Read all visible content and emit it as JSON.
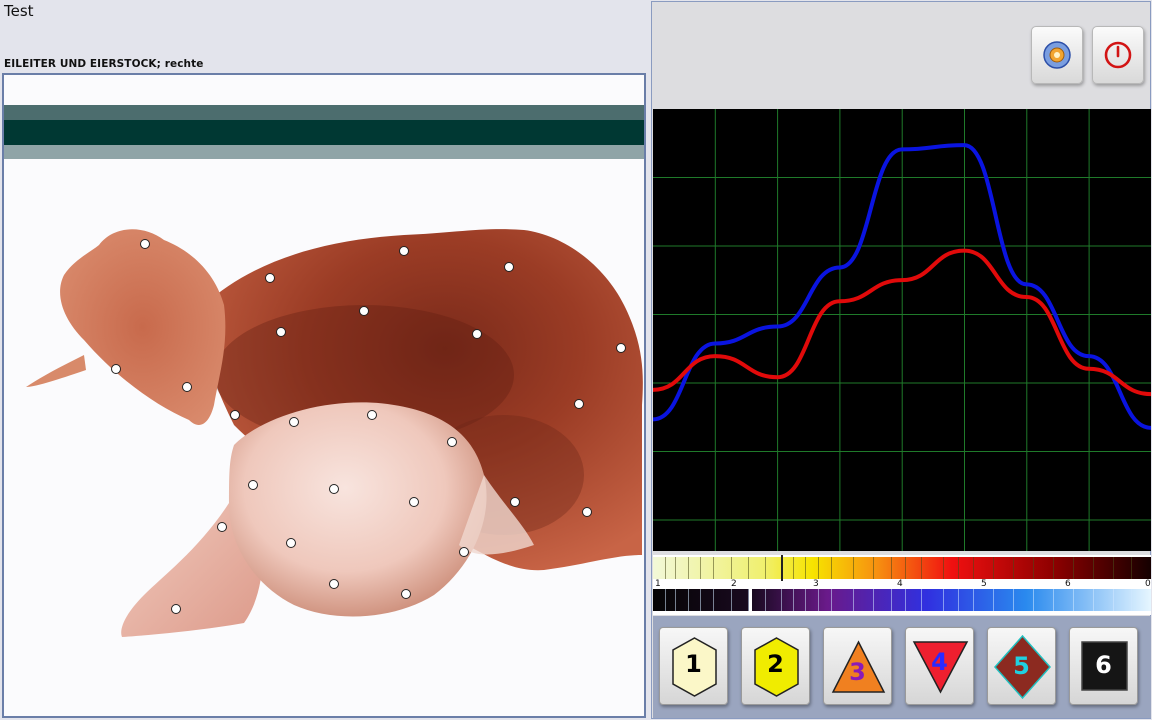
{
  "window": {
    "title": "Test"
  },
  "organ": {
    "label": "EILEITER UND EIERSTOCK;  rechte"
  },
  "image": {
    "measurement_points": 26
  },
  "toolbar": {
    "tool_button_icon": "gear-sphere-icon",
    "power_button_icon": "power-icon"
  },
  "graph": {
    "background": "#000000",
    "grid_color": "#1f7a2a",
    "series": [
      {
        "color": "#0a14e0",
        "values": [
          0.3,
          0.48,
          0.52,
          0.66,
          0.94,
          0.95,
          0.62,
          0.45,
          0.28
        ]
      },
      {
        "color": "#e10a0a",
        "values": [
          0.37,
          0.45,
          0.4,
          0.58,
          0.63,
          0.7,
          0.59,
          0.42,
          0.36
        ]
      }
    ]
  },
  "spectrum": {
    "scale_labels": [
      "1",
      "2",
      "3",
      "4",
      "5",
      "6",
      "0"
    ]
  },
  "number_buttons": [
    {
      "label": "1",
      "shape": "hexagon",
      "fill": "#fbf7c8",
      "text_color": "#000000"
    },
    {
      "label": "2",
      "shape": "hexagon",
      "fill": "#f0ec00",
      "text_color": "#000000"
    },
    {
      "label": "3",
      "shape": "triangle-up",
      "fill": "#f08020",
      "text_color": "#8a1ab8"
    },
    {
      "label": "4",
      "shape": "triangle-down",
      "fill": "#ee1f2f",
      "text_color": "#2a2aff"
    },
    {
      "label": "5",
      "shape": "diamond",
      "fill": "#8c2a20",
      "text_color": "#20d0e0"
    },
    {
      "label": "6",
      "shape": "square",
      "fill": "#151515",
      "text_color": "#ffffff"
    }
  ]
}
